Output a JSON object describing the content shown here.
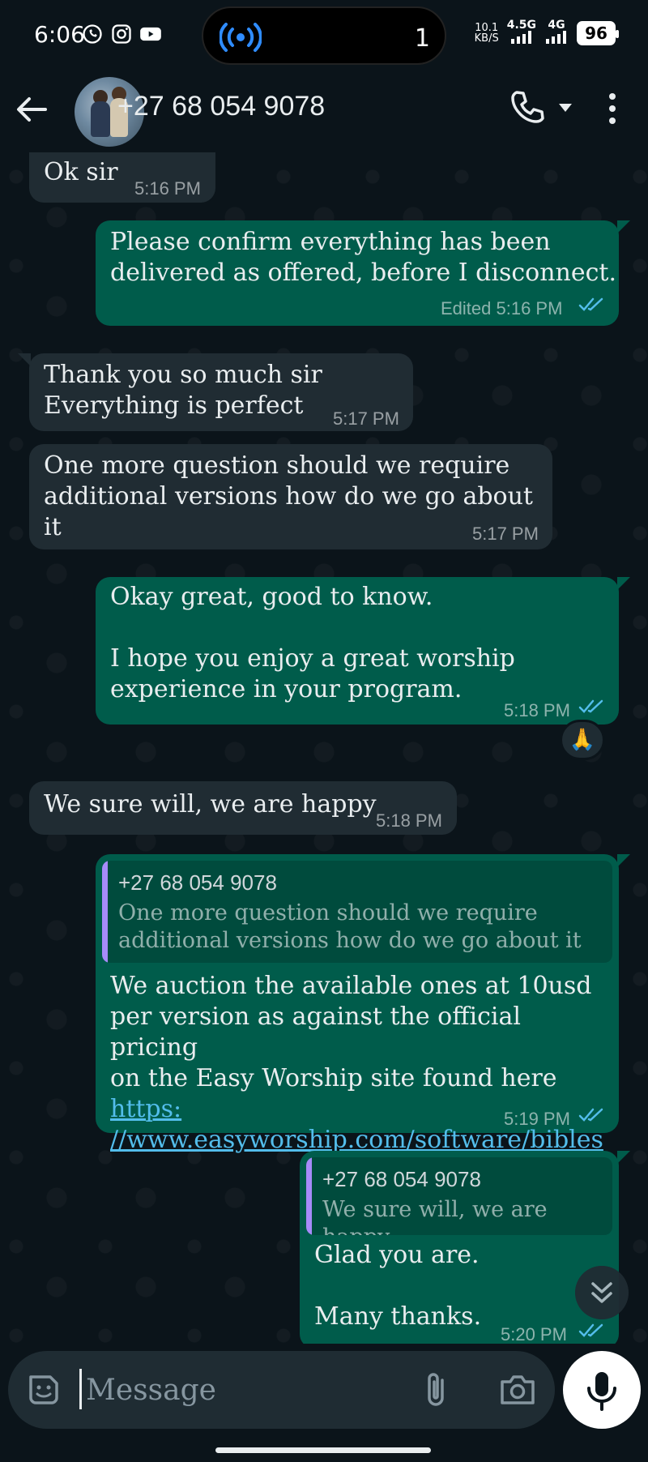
{
  "status_bar": {
    "time": "6:06",
    "cast_count": "1",
    "net_speed_value": "10.1",
    "net_speed_unit": "KB/S",
    "net1": "4.5G",
    "net2": "4G",
    "battery": "96"
  },
  "header": {
    "contact": "+27 68 054 9078"
  },
  "colors": {
    "incoming_bubble": "#202c33",
    "outgoing_bubble": "#005c4b",
    "read_ticks": "#53bdeb",
    "background": "#0b141a"
  },
  "messages": [
    {
      "direction": "in",
      "text": "Ok sir",
      "time": "5:16 PM"
    },
    {
      "direction": "out",
      "text": "Please confirm everything has been\ndelivered as offered, before I disconnect.",
      "time": "Edited 5:16 PM",
      "status": "read"
    },
    {
      "direction": "in",
      "text": "Thank you so much sir\nEverything is perfect",
      "time": "5:17 PM"
    },
    {
      "direction": "in",
      "text": "One more question should we require\nadditional versions how do we go about it",
      "time": "5:17 PM"
    },
    {
      "direction": "out",
      "text": "Okay great, good to know.\n\nI hope you enjoy a great worship\nexperience in your program.",
      "time": "5:18 PM",
      "status": "read",
      "reaction": "🙏"
    },
    {
      "direction": "in",
      "text": "We sure will, we are happy",
      "time": "5:18 PM"
    },
    {
      "direction": "out",
      "quote_author": "+27 68 054 9078",
      "quote_text": "One more question should we require\nadditional versions how do we go about it",
      "text": "We auction the available ones at 10usd\nper version as against the official pricing\non the Easy Worship site found here",
      "link_part1": "https:",
      "link_part2": "//www.easyworship.com/software/bibles",
      "time": "5:19 PM",
      "status": "read"
    },
    {
      "direction": "out",
      "quote_author": "+27 68 054 9078",
      "quote_text": "We sure will, we are happy",
      "text": "Glad you are.\n\nMany thanks.",
      "time": "5:20 PM",
      "status": "read"
    }
  ],
  "composer": {
    "placeholder": "Message"
  },
  "icons": {
    "status": [
      "whatsapp-icon",
      "instagram-icon",
      "youtube-icon"
    ],
    "header": [
      "back-arrow-icon",
      "phone-icon",
      "chevron-down-icon",
      "more-vert-icon"
    ],
    "composer": [
      "sticker-icon",
      "paperclip-icon",
      "camera-icon",
      "mic-icon"
    ]
  }
}
